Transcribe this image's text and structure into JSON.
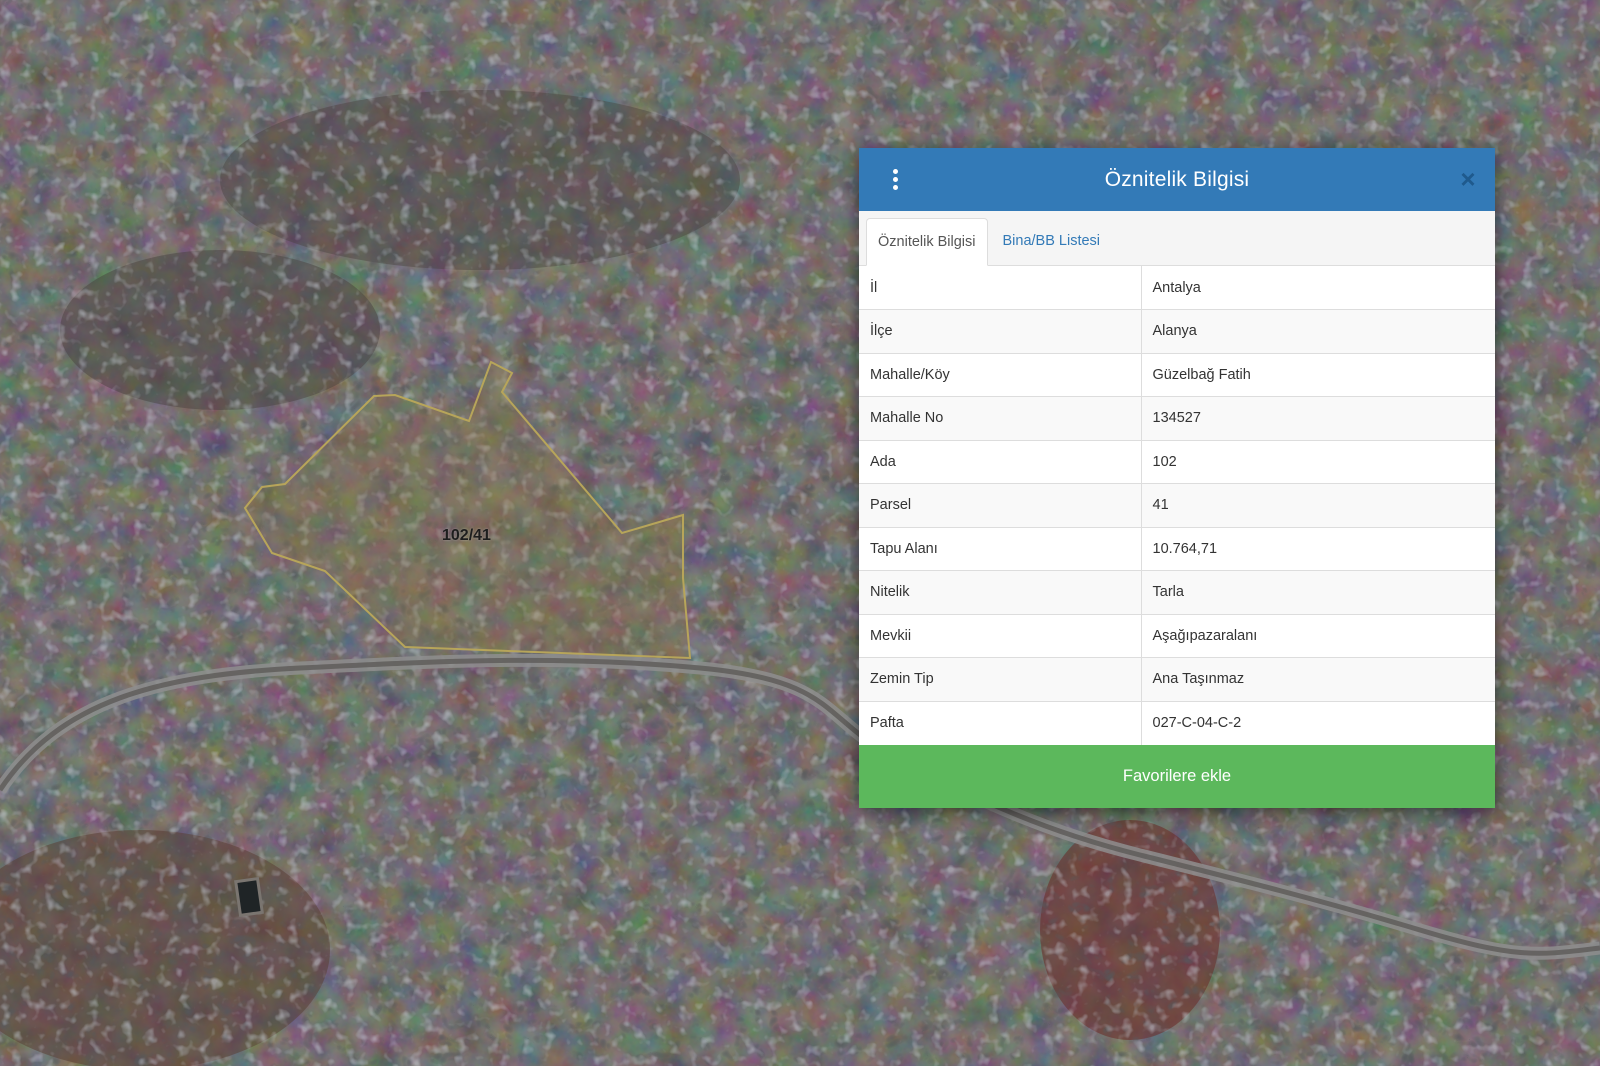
{
  "map": {
    "parcel_label": "102/41",
    "parcel_outline_color": "#b7a55a",
    "road_color": "#8e8e8e"
  },
  "popup": {
    "title": "Öznitelik Bilgisi",
    "menu_icon": "vertical-ellipsis-icon",
    "close_label": "×",
    "tabs": [
      {
        "label": "Öznitelik Bilgisi",
        "active": true
      },
      {
        "label": "Bina/BB Listesi",
        "active": false
      }
    ],
    "rows": [
      {
        "key": "İl",
        "value": "Antalya"
      },
      {
        "key": "İlçe",
        "value": "Alanya"
      },
      {
        "key": "Mahalle/Köy",
        "value": "Güzelbağ Fatih"
      },
      {
        "key": "Mahalle No",
        "value": "134527"
      },
      {
        "key": "Ada",
        "value": "102"
      },
      {
        "key": "Parsel",
        "value": "41"
      },
      {
        "key": "Tapu Alanı",
        "value": "10.764,71"
      },
      {
        "key": "Nitelik",
        "value": "Tarla"
      },
      {
        "key": "Mevkii",
        "value": "Aşağıpazaralanı"
      },
      {
        "key": "Zemin Tip",
        "value": "Ana Taşınmaz"
      },
      {
        "key": "Pafta",
        "value": "027-C-04-C-2"
      }
    ],
    "favorite_button": "Favorilere ekle",
    "header_color": "#337ab7",
    "button_color": "#5cb85c"
  }
}
